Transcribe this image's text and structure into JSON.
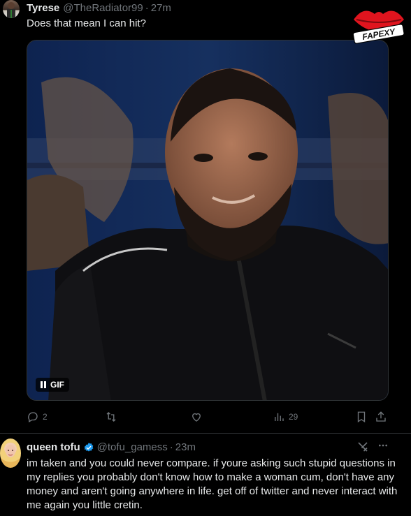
{
  "tweet1": {
    "display_name": "Tyrese",
    "handle": "@TheRadiator99",
    "separator": "·",
    "time": "27m",
    "text": "Does that mean I can hit?",
    "media": {
      "badge": "GIF"
    },
    "actions": {
      "replies": "2",
      "views": "29"
    }
  },
  "tweet2": {
    "display_name": "queen tofu",
    "handle": "@tofu_gamess",
    "separator": "·",
    "time": "23m",
    "text": "im taken and you could never compare. if youre asking such stupid questions in my replies you probably don't know how to make a woman cum, don't have any money and aren't going anywhere in life. get off of twitter and never interact with me again you little cretin."
  },
  "watermark": {
    "text": "FAPEXY"
  },
  "colors": {
    "background": "#000000",
    "text": "#e7e9ea",
    "muted": "#71767b",
    "verified": "#1d9bf0",
    "border": "#2f3336"
  }
}
